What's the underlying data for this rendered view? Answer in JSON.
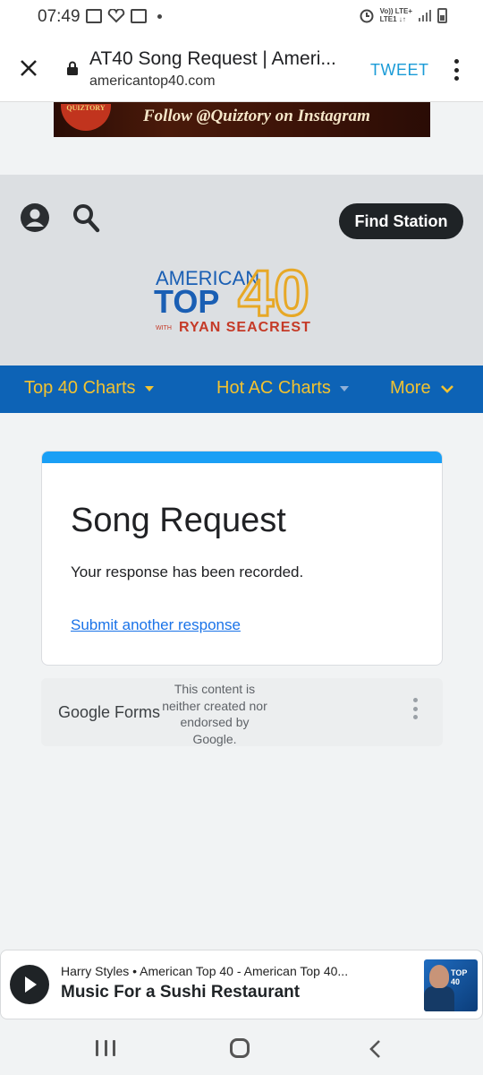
{
  "status_bar": {
    "time": "07:49",
    "network_label_top": "Vo)) LTE+",
    "network_label_bottom": "LTE1 ↓↑"
  },
  "browser": {
    "page_title": "AT40 Song Request | Ameri...",
    "url": "americantop40.com",
    "tweet_label": "TWEET"
  },
  "ad_banner": {
    "badge_text": "QUIZTORY",
    "text": "Follow @Quiztory on Instagram"
  },
  "site_header": {
    "find_station_label": "Find Station",
    "logo": {
      "line1": "AMERICAN",
      "line2": "TOP",
      "number": "40",
      "with": "WITH",
      "host": "RYAN SEACREST"
    }
  },
  "nav": {
    "items": [
      {
        "label": "Top 40 Charts"
      },
      {
        "label": "Hot AC Charts"
      },
      {
        "label": "More"
      }
    ]
  },
  "form": {
    "title": "Song Request",
    "message": "Your response has been recorded.",
    "link": "Submit another response",
    "accent_color": "#1a9ff5"
  },
  "google_forms": {
    "logo_text": "Google Forms",
    "disclaimer": "This content is neither created nor endorsed by Google."
  },
  "player": {
    "subtitle": "Harry Styles • American Top 40 - American Top 40...",
    "title": "Music For a Sushi Restaurant",
    "art_label": "TOP 40"
  },
  "colors": {
    "nav_bg": "#0d63b6",
    "nav_text": "#f2c230",
    "tweet": "#1a9bd7"
  }
}
